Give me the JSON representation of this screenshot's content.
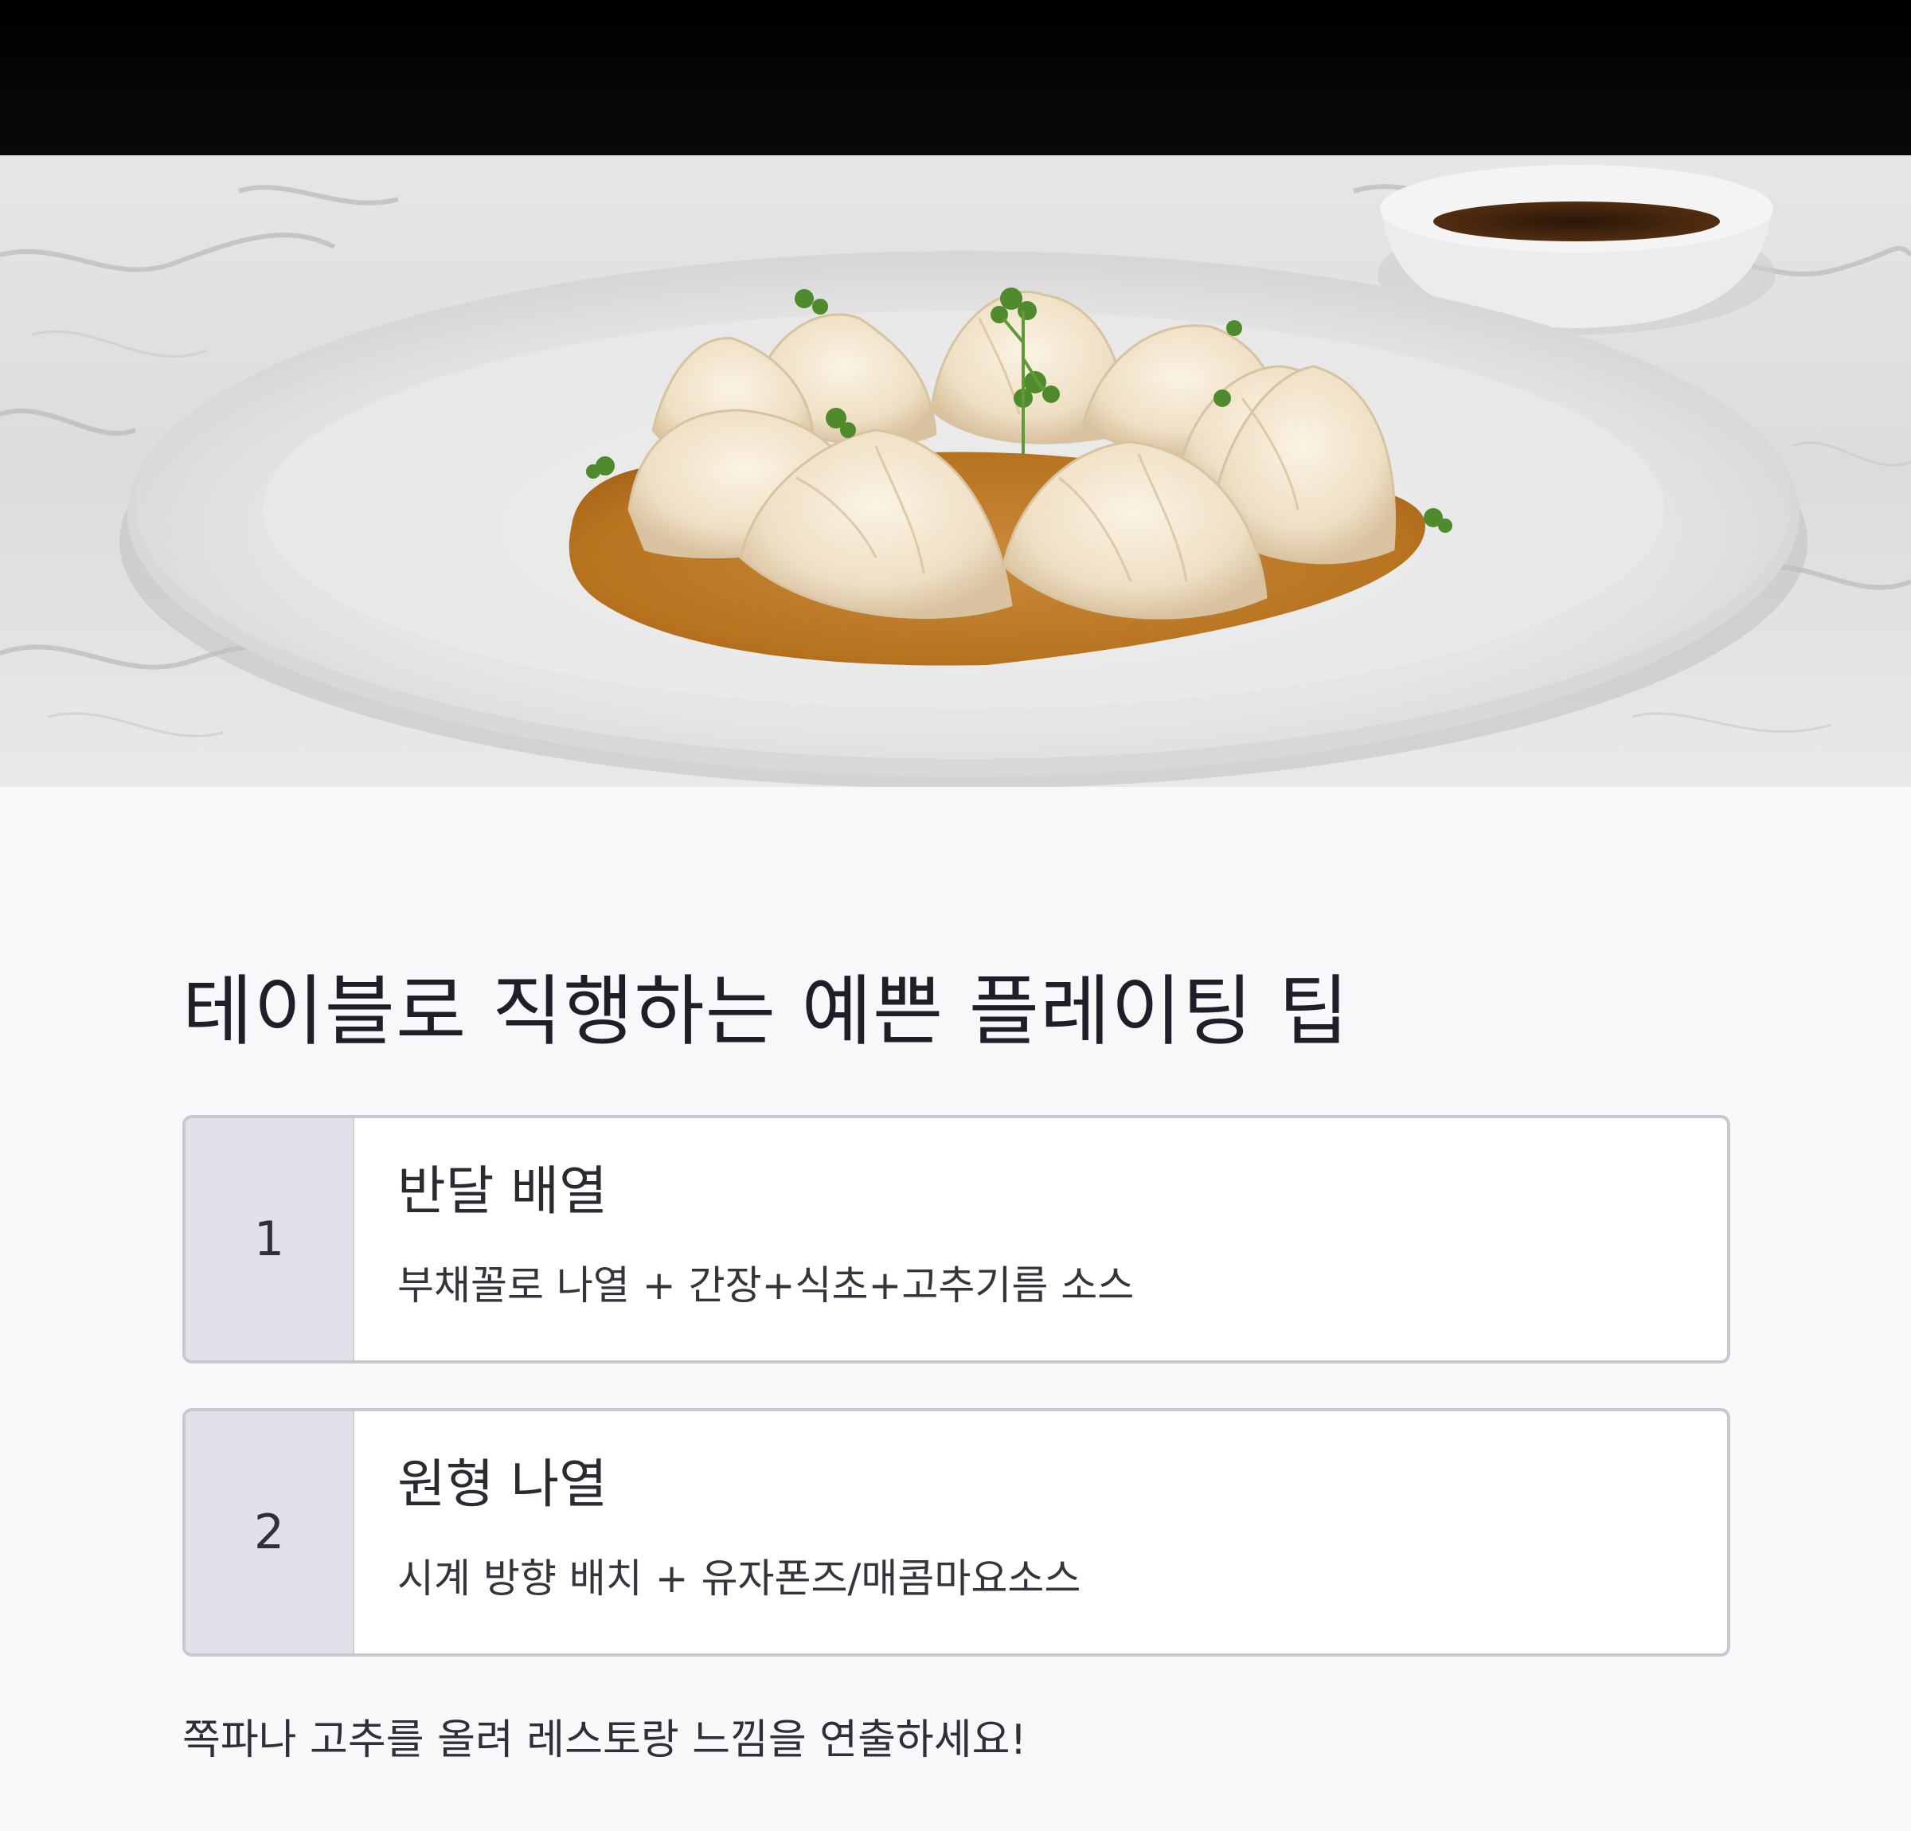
{
  "hero": {
    "image": "dumpling-plating-photo",
    "description_icon": "plate-of-dumplings-with-dipping-sauce"
  },
  "title": "테이블로 직행하는 예쁜 플레이팅 팁",
  "tips": [
    {
      "number": "1",
      "title": "반달 배열",
      "description": "부채꼴로 나열 + 간장+식초+고추기름 소스"
    },
    {
      "number": "2",
      "title": "원형 나열",
      "description": "시계 방향 배치 + 유자폰즈/매콤마요소스"
    }
  ],
  "footer_note": "쪽파나 고추를 올려 레스토랑 느낌을 연출하세요!",
  "colors": {
    "background": "#f8f8fa",
    "number_cell": "#e1e1ea",
    "card_border": "#c8c8d0",
    "text": "#2b2b35"
  }
}
